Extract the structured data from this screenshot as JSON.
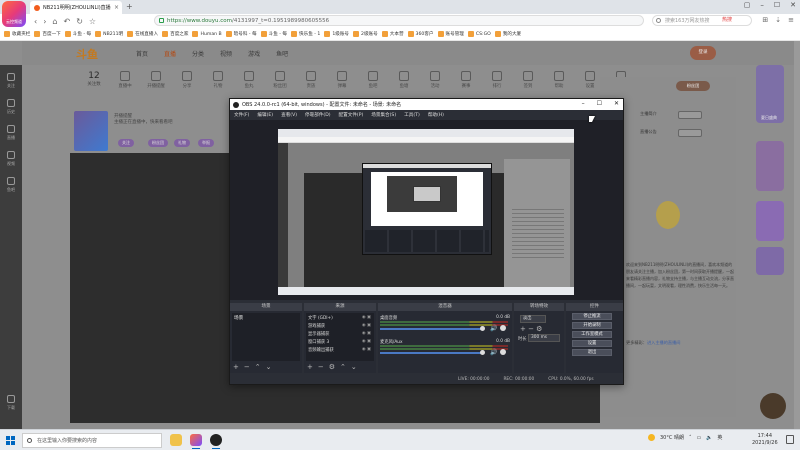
{
  "browser": {
    "logo_label": "云控频道",
    "tab_title": "NB211明明(ZHOULINLI)直播",
    "address_url": "https://www.douyu.com",
    "address_path": "/4131997_t=0.1951989980605556",
    "search_placeholder": "搜索163万网友热搜",
    "hot_label": "热搜",
    "bookmarks": [
      "收藏夹栏",
      "百度一下",
      "斗鱼 - 每",
      "NB211明",
      "在线直播入",
      "百度之家",
      "Human B",
      "暗号科 - 每",
      "斗鱼 - 每",
      "快乐鱼 - 1",
      "1级账号",
      "2级账号",
      "大本营",
      "360客户",
      "账号管理",
      "CS:GO",
      "我的大厦"
    ]
  },
  "site": {
    "logo": "斗鱼",
    "nav": [
      "首页",
      "直播",
      "分类",
      "视频",
      "游戏",
      "鱼吧"
    ],
    "login": "登录",
    "categories": [
      {
        "label": "关注数",
        "value": "12"
      },
      {
        "label": "直播中",
        "value": ""
      },
      {
        "label": "开播提醒",
        "value": ""
      },
      {
        "label": "分享",
        "value": ""
      },
      {
        "label": "礼物",
        "value": ""
      },
      {
        "label": "鱼丸",
        "value": ""
      },
      {
        "label": "粉丝团",
        "value": ""
      },
      {
        "label": "贵族",
        "value": ""
      },
      {
        "label": "弹幕",
        "value": ""
      },
      {
        "label": "鱼吧",
        "value": ""
      },
      {
        "label": "鱼塘",
        "value": ""
      },
      {
        "label": "活动",
        "value": ""
      },
      {
        "label": "赛事",
        "value": ""
      },
      {
        "label": "排行",
        "value": ""
      },
      {
        "label": "签到",
        "value": ""
      },
      {
        "label": "帮助",
        "value": ""
      },
      {
        "label": "设置",
        "value": ""
      },
      {
        "label": "客服",
        "value": ""
      }
    ],
    "streamer_status": "开播提醒",
    "streamer_sub": "主播正在直播中，快来看看吧",
    "tags": [
      "关注",
      "粉丝团",
      "礼物",
      "举报"
    ],
    "fans_button": "粉丝团",
    "right_items": [
      "主播简介",
      "直播公告"
    ],
    "article": "欢迎来到NB211明明(ZHOULINLI)的直播间，喜欢本频道的朋友请关注主播，加入粉丝团，第一时间获取开播提醒，一起来看精彩直播内容，礼物支持主播，与主播互动交流，分享直播间，一起玩耍，文明观看，理性消费，快乐生活每一天。",
    "article_link_pre": "更多精彩：",
    "article_link": "进入主播的直播间",
    "promo_label": "夏日盛典",
    "left_rail": [
      "关注",
      "历史",
      "直播",
      "视频",
      "鱼吧",
      "下载"
    ]
  },
  "obs": {
    "title": "OBS 24.0.0-rc1 (64-bit, windows) - 配置文件: 未命名 - 场景: 未命名",
    "menu": [
      "文件(F)",
      "编辑(E)",
      "查看(V)",
      "停靠部件(D)",
      "配置文件(P)",
      "场景集合(S)",
      "工具(T)",
      "帮助(H)"
    ],
    "docks": {
      "scenes": "场景",
      "sources": "来源",
      "mixer": "混音器",
      "transitions": "转场特效",
      "controls": "控件"
    },
    "scene_item": "场景",
    "sources": [
      "文字 (GDI+)",
      "游戏捕获",
      "显示器捕获",
      "窗口捕获 3",
      "音频输出捕获"
    ],
    "mixer": [
      {
        "name": "桌面音频",
        "db": "0.0 dB"
      },
      {
        "name": "麦克风/Aux",
        "db": "0.0 dB"
      }
    ],
    "transition": "淡出",
    "duration_label": "时长",
    "duration": "300 ms",
    "controls": [
      "停止推流",
      "开始录制",
      "工作室模式",
      "设置",
      "退出"
    ],
    "status": [
      "LIVE: 00:00:00",
      "REC: 00:00:00",
      "CPU: 0.0%, 60.00 fps"
    ]
  },
  "taskbar": {
    "search": "在这里输入你要搜索的内容",
    "weather": "30°C 晴朗",
    "lang": "英",
    "time": "17:44",
    "date": "2021/9/26"
  }
}
